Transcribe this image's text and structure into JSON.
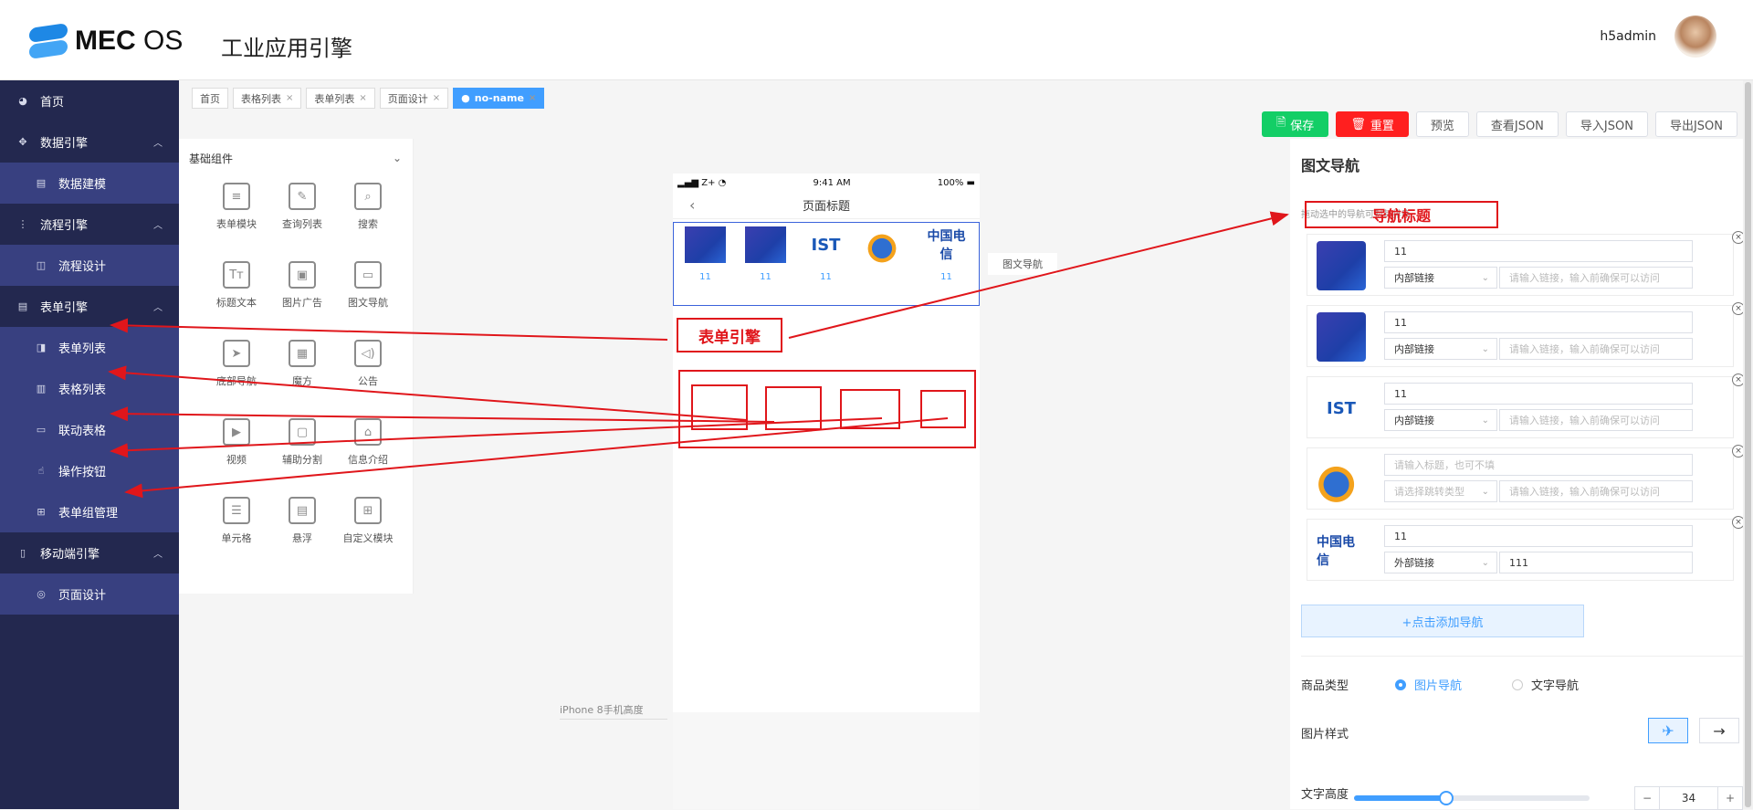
{
  "header": {
    "logo_bold": "MEC",
    "logo_light": "OS",
    "app_title": "工业应用引擎",
    "username": "h5admin"
  },
  "sidebar": {
    "items": [
      {
        "label": "首页",
        "icon": "dashboard-icon",
        "type": "top",
        "chevron": false
      },
      {
        "label": "数据引擎",
        "icon": "move-icon",
        "type": "top",
        "chevron": true
      },
      {
        "label": "数据建模",
        "icon": "document-icon",
        "type": "sub"
      },
      {
        "label": "流程引擎",
        "icon": "flow-icon",
        "type": "top",
        "chevron": true
      },
      {
        "label": "流程设计",
        "icon": "flow-design-icon",
        "type": "sub"
      },
      {
        "label": "表单引擎",
        "icon": "document-icon",
        "type": "top",
        "chevron": true
      },
      {
        "label": "表单列表",
        "icon": "document-copy-icon",
        "type": "sub"
      },
      {
        "label": "表格列表",
        "icon": "table-icon",
        "type": "sub"
      },
      {
        "label": "联动表格",
        "icon": "linked-table-icon",
        "type": "sub"
      },
      {
        "label": "操作按钮",
        "icon": "pointer-icon",
        "type": "sub"
      },
      {
        "label": "表单组管理",
        "icon": "grid-icon",
        "type": "sub"
      },
      {
        "label": "移动端引擎",
        "icon": "mobile-icon",
        "type": "top",
        "chevron": true
      },
      {
        "label": "页面设计",
        "icon": "page-design-icon",
        "type": "sub"
      }
    ]
  },
  "tabs": [
    {
      "label": "首页",
      "closable": false,
      "active": false
    },
    {
      "label": "表格列表",
      "closable": true,
      "active": false
    },
    {
      "label": "表单列表",
      "closable": true,
      "active": false
    },
    {
      "label": "页面设计",
      "closable": true,
      "active": false
    },
    {
      "label": "no-name",
      "closable": true,
      "active": true
    }
  ],
  "toolbar": {
    "save": "保存",
    "reset": "重置",
    "preview": "预览",
    "view_json": "查看JSON",
    "import_json": "导入JSON",
    "export_json": "导出JSON"
  },
  "palette": {
    "title": "基础组件",
    "components": [
      {
        "label": "表单模块",
        "icon": "form-module-icon",
        "glyph": "≡"
      },
      {
        "label": "查询列表",
        "icon": "query-list-icon",
        "glyph": "✎"
      },
      {
        "label": "搜索",
        "icon": "search-icon",
        "glyph": "⌕"
      },
      {
        "label": "标题文本",
        "icon": "title-text-icon",
        "glyph": "Tт"
      },
      {
        "label": "图片广告",
        "icon": "image-ad-icon",
        "glyph": "▣"
      },
      {
        "label": "图文导航",
        "icon": "image-nav-icon",
        "glyph": "▭"
      },
      {
        "label": "底部导航",
        "icon": "paper-plane-icon",
        "glyph": "➤"
      },
      {
        "label": "魔方",
        "icon": "cube-layout-icon",
        "glyph": "▦"
      },
      {
        "label": "公告",
        "icon": "announcement-icon",
        "glyph": "◁)"
      },
      {
        "label": "视频",
        "icon": "video-icon",
        "glyph": "▶"
      },
      {
        "label": "辅助分割",
        "icon": "divider-icon",
        "glyph": "▢"
      },
      {
        "label": "信息介绍",
        "icon": "store-info-icon",
        "glyph": "⌂"
      },
      {
        "label": "单元格",
        "icon": "cell-icon",
        "glyph": "☰"
      },
      {
        "label": "悬浮",
        "icon": "float-icon",
        "glyph": "▤"
      },
      {
        "label": "自定义模块",
        "icon": "custom-module-icon",
        "glyph": "⊞"
      }
    ]
  },
  "canvas": {
    "device_note": "iPhone 8手机高度"
  },
  "phone": {
    "carrier": "Z+",
    "time": "9:41 AM",
    "battery": "100%",
    "page_title": "页面标题",
    "nav_items": [
      {
        "label": "11",
        "image": "blue-gradient"
      },
      {
        "label": "11",
        "image": "blue-gradient"
      },
      {
        "label": "11",
        "image": "brand-logo-text"
      },
      {
        "label": "",
        "image": "brand-logo-swirl"
      },
      {
        "label": "11",
        "image": "china-telecom-logo"
      }
    ],
    "component_tag": "图文导航"
  },
  "annotations": {
    "form_engine": "表单引擎",
    "nav_title": "导航标题"
  },
  "panel": {
    "title": "图文导航",
    "hint": "拖动选中的导航可对其排序",
    "rows": [
      {
        "title": "11",
        "title_placeholder": "",
        "link_type": "内部链接",
        "link_value": "",
        "link_placeholder": "请输入链接，输入前确保可以访问",
        "image": "blue-gradient"
      },
      {
        "title": "11",
        "title_placeholder": "",
        "link_type": "内部链接",
        "link_value": "",
        "link_placeholder": "请输入链接，输入前确保可以访问",
        "image": "blue-gradient"
      },
      {
        "title": "11",
        "title_placeholder": "",
        "link_type": "内部链接",
        "link_value": "",
        "link_placeholder": "请输入链接，输入前确保可以访问",
        "image": "brand-logo-text"
      },
      {
        "title": "",
        "title_placeholder": "请输入标题，也可不填",
        "link_type": "",
        "link_type_placeholder": "请选择跳转类型",
        "link_value": "",
        "link_placeholder": "请输入链接，输入前确保可以访问",
        "image": "brand-logo-swirl"
      },
      {
        "title": "11",
        "title_placeholder": "",
        "link_type": "外部链接",
        "link_value": "111",
        "link_placeholder": "",
        "image": "china-telecom-logo"
      }
    ],
    "add_button": "+点击添加导航",
    "goods_type_label": "商品类型",
    "goods_type_options": [
      "图片导航",
      "文字导航"
    ],
    "goods_type_selected": "图片导航",
    "image_style_label": "图片样式",
    "image_style_options": [
      "pin-icon",
      "arrow-right-icon"
    ],
    "image_style_selected": "pin-icon",
    "text_height_label": "文字高度",
    "text_height_value": "34",
    "text_height_fraction": 0.39
  },
  "colors": {
    "sidebar_bg": "#23284f",
    "sidebar_sub_bg": "#384080",
    "accent": "#409eff",
    "save": "#13ce66",
    "reset": "#ff1f1f",
    "annotation": "#e0161b"
  }
}
